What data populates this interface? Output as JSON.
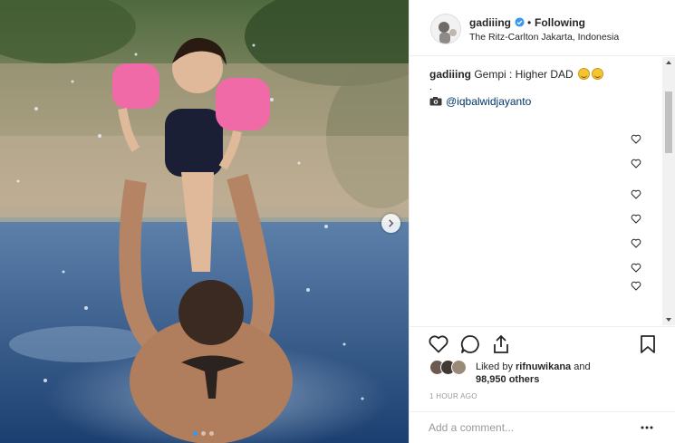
{
  "post": {
    "username": "gadiiing",
    "separator": "•",
    "follow_status": "Following",
    "location": "The Ritz-Carlton Jakarta, Indonesia",
    "verified_icon": "verified-badge-icon",
    "accent_color": "#3897f0"
  },
  "caption": {
    "username": "gadiiing",
    "text": " Gempi : Higher DAD ",
    "continuation": ".",
    "credit_mention": "@iqbalwidjayanto"
  },
  "comment_likes": {
    "count": 7,
    "icon": "heart-outline-icon"
  },
  "actions": {
    "like_icon": "heart-icon",
    "comment_icon": "comment-icon",
    "share_icon": "share-icon",
    "save_icon": "bookmark-icon"
  },
  "likes": {
    "prefix": "Liked by ",
    "user": "rifnuwikana",
    "conjunction": " and",
    "count_text": "98,950 others"
  },
  "time_ago": "1 HOUR AGO",
  "comment_placeholder": "Add a comment...",
  "carousel": {
    "slides": 3,
    "active": 0
  }
}
